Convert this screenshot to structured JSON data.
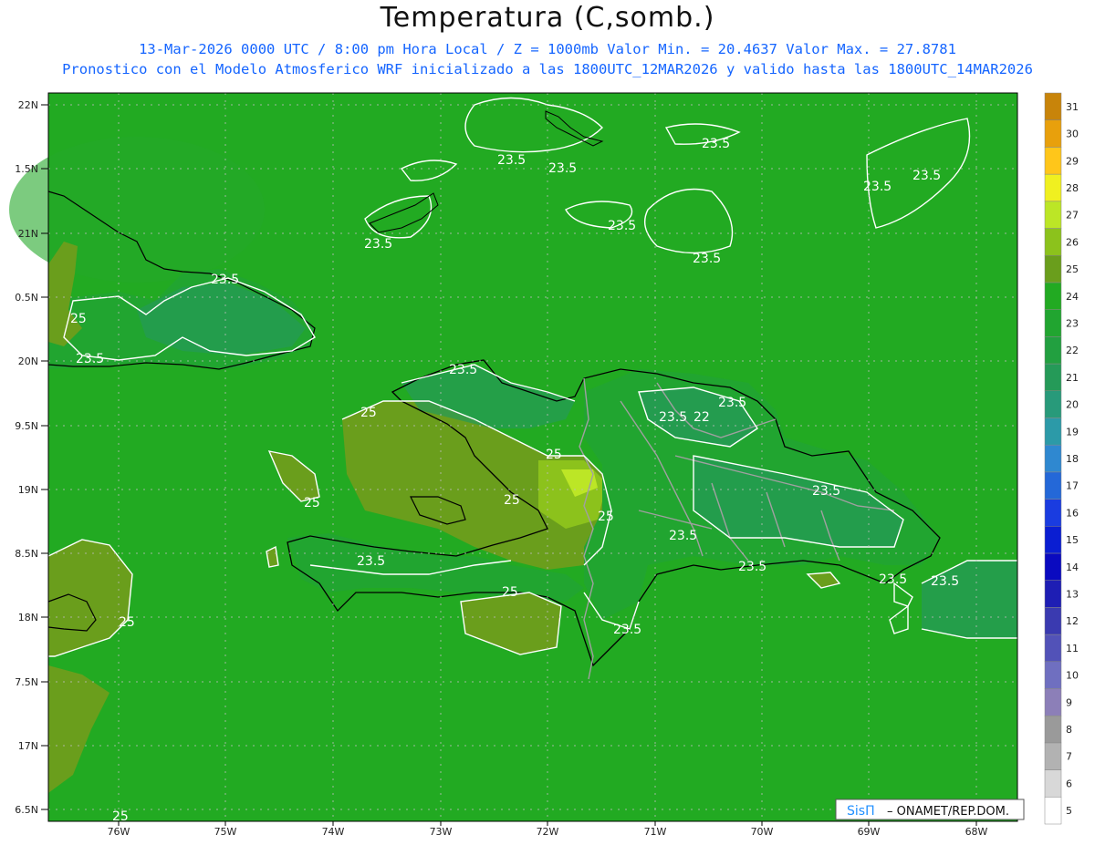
{
  "header": {
    "title": "Temperatura (C,somb.)",
    "subtitle_line1": "13-Mar-2026  0000 UTC / 8:00 pm Hora Local / Z = 1000mb   Valor Min. = 20.4637  Valor Max. = 27.8781",
    "subtitle_line2": "Pronostico con el Modelo Atmosferico WRF inicializado a las 1800UTC_12MAR2026 y valido hasta las  1800UTC_14MAR2026"
  },
  "axes": {
    "lat_labels": [
      "22N",
      "1.5N",
      "21N",
      "0.5N",
      "20N",
      "9.5N",
      "19N",
      "8.5N",
      "18N",
      "7.5N",
      "17N",
      "6.5N"
    ],
    "lon_labels": [
      "76W",
      "75W",
      "74W",
      "73W",
      "72W",
      "71W",
      "70W",
      "69W",
      "68W"
    ]
  },
  "colorbar": {
    "levels": [
      "5",
      "6",
      "7",
      "8",
      "9",
      "10",
      "11",
      "12",
      "13",
      "14",
      "15",
      "16",
      "17",
      "18",
      "19",
      "20",
      "21",
      "22",
      "23",
      "24",
      "25",
      "26",
      "27",
      "28",
      "29",
      "30",
      "31"
    ],
    "colors": [
      "#ffffff",
      "#d8d8d8",
      "#b2b2b2",
      "#9a9a9a",
      "#8c7fb8",
      "#6f6fc0",
      "#5252b8",
      "#3a3ab0",
      "#1e1eb4",
      "#0a0ac0",
      "#0a1ed2",
      "#1a3ce0",
      "#2468d8",
      "#2f88d0",
      "#2c9aa8",
      "#289a7a",
      "#259a58",
      "#22a040",
      "#21a530",
      "#22aa22",
      "#6a9e1c",
      "#8cc21c",
      "#bce626",
      "#f0f020",
      "#ffc61a",
      "#e8a00c",
      "#c8840a"
    ]
  },
  "colors": {
    "background_field": "#22aa22",
    "field_23": "#21a530",
    "field_22": "#259a58",
    "field_25": "#6a9e1c",
    "field_26": "#8cc21c",
    "field_27": "#bce626",
    "coastline": "#000000",
    "borders": "#a0a0a0",
    "contour": "#ffffff"
  },
  "contour_labels": [
    "23.5",
    "23.5",
    "23.5",
    "23.5",
    "23.5",
    "23.5",
    "23.5",
    "23.5",
    "23.5",
    "23.5",
    "23.5",
    "23.5",
    "23.5",
    "23.5",
    "23.5",
    "23.5",
    "22",
    "25",
    "25",
    "25",
    "25",
    "25",
    "25",
    "25",
    "25",
    "25"
  ],
  "credit": {
    "brand": "SisΠ",
    "text": "– ONAMET/REP.DOM."
  }
}
